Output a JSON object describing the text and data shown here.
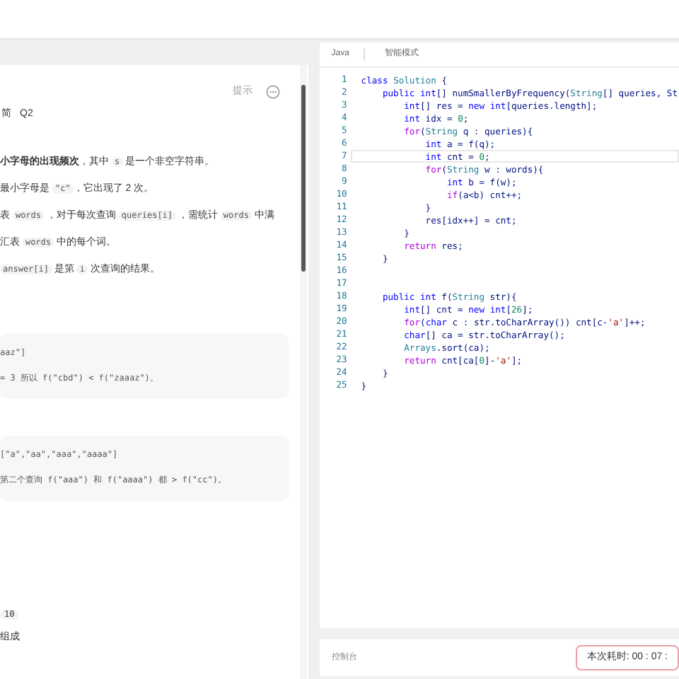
{
  "problem": {
    "hint_label": "提示",
    "tag": "简",
    "number": "Q2",
    "paragraphs": [
      [
        {
          "kind": "bold",
          "text": "小字母的出现频次"
        },
        {
          "kind": "text",
          "text": "，其中 "
        },
        {
          "kind": "code",
          "text": "s"
        },
        {
          "kind": "text",
          "text": " 是一个非空字符串。"
        }
      ],
      [
        {
          "kind": "text",
          "text": "最小字母是 "
        },
        {
          "kind": "code",
          "text": "\"c\""
        },
        {
          "kind": "text",
          "text": "，它出现了 2 次。"
        }
      ],
      [
        {
          "kind": "text",
          "text": "表 "
        },
        {
          "kind": "code",
          "text": "words"
        },
        {
          "kind": "text",
          "text": " ，对于每次查询 "
        },
        {
          "kind": "code",
          "text": "queries[i]"
        },
        {
          "kind": "text",
          "text": " ，需统计 "
        },
        {
          "kind": "code",
          "text": "words"
        },
        {
          "kind": "text",
          "text": " 中满"
        }
      ],
      [
        {
          "kind": "text",
          "text": "汇表 "
        },
        {
          "kind": "code",
          "text": "words"
        },
        {
          "kind": "text",
          "text": " 中的每个词。"
        }
      ],
      [
        {
          "kind": "code",
          "text": "answer[i]"
        },
        {
          "kind": "text",
          "text": " 是第 "
        },
        {
          "kind": "code",
          "text": "i"
        },
        {
          "kind": "text",
          "text": " 次查询的结果。"
        }
      ]
    ],
    "examples": [
      [
        "aaz\"]",
        "= 3 所以 f(\"cbd\") < f(\"zaaaz\")。"
      ],
      [
        "[\"a\",\"aa\",\"aaa\",\"aaaa\"]",
        "第二个查询 f(\"aaa\") 和 f(\"aaaa\") 都 > f(\"cc\")。"
      ]
    ],
    "constraint_value": "10",
    "constraint_text": "组成"
  },
  "editor": {
    "language": "Java",
    "mode": "智能模式",
    "lines": [
      {
        "number": "1",
        "code": "class Solution {",
        "selected": false
      },
      {
        "number": "2",
        "code": "    public int[] numSmallerByFrequency(String[] queries, St",
        "selected": false
      },
      {
        "number": "3",
        "code": "        int[] res = new int[queries.length];",
        "selected": false
      },
      {
        "number": "4",
        "code": "        int idx = 0;",
        "selected": false
      },
      {
        "number": "5",
        "code": "        for(String q : queries){",
        "selected": false
      },
      {
        "number": "6",
        "code": "            int a = f(q);",
        "selected": false
      },
      {
        "number": "7",
        "code": "            int cnt = 0;",
        "selected": true
      },
      {
        "number": "8",
        "code": "            for(String w : words){",
        "selected": false
      },
      {
        "number": "9",
        "code": "                int b = f(w);",
        "selected": false
      },
      {
        "number": "10",
        "code": "                if(a<b) cnt++;",
        "selected": false
      },
      {
        "number": "11",
        "code": "            }",
        "selected": false
      },
      {
        "number": "12",
        "code": "            res[idx++] = cnt;",
        "selected": false
      },
      {
        "number": "13",
        "code": "        }",
        "selected": false
      },
      {
        "number": "14",
        "code": "        return res;",
        "selected": false
      },
      {
        "number": "15",
        "code": "    }",
        "selected": false
      },
      {
        "number": "16",
        "selected": false
      },
      {
        "number": "17",
        "selected": false
      },
      {
        "number": "18",
        "code": "    public int f(String str){",
        "selected": false
      },
      {
        "number": "19",
        "code": "        int[] cnt = new int[26];",
        "selected": false
      },
      {
        "number": "20",
        "code": "        for(char c : str.toCharArray()) cnt[c-'a']++;",
        "selected": false
      },
      {
        "number": "21",
        "code": "        char[] ca = str.toCharArray();",
        "selected": false
      },
      {
        "number": "22",
        "code": "        Arrays.sort(ca);",
        "selected": false
      },
      {
        "number": "23",
        "code": "        return cnt[ca[0]-'a'];",
        "selected": false
      },
      {
        "number": "24",
        "code": "    }",
        "selected": false
      },
      {
        "number": "25",
        "code": "}",
        "selected": false
      }
    ]
  },
  "footer": {
    "console": "控制台",
    "timer": "本次耗时: 00 : 07 :"
  }
}
